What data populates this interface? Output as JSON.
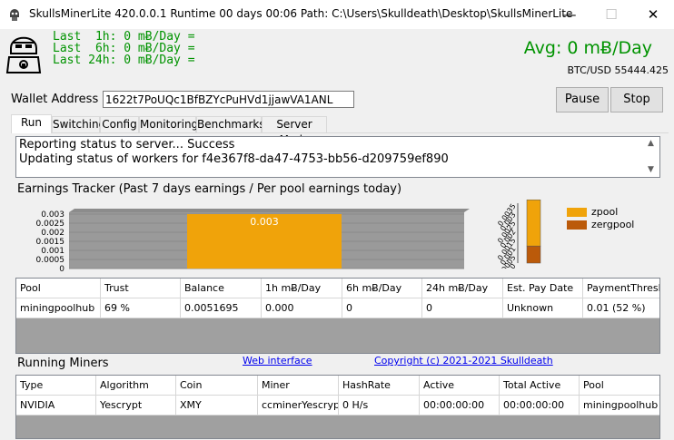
{
  "window": {
    "title": "SkullsMinerLite 420.0.0.1 Runtime 00 days 00:06 Path: C:\\Users\\Skulldeath\\Desktop\\SkullsMinerLite",
    "minimize_glyph": "—",
    "maximize_glyph": "☐",
    "close_glyph": "✕"
  },
  "header": {
    "stats": [
      "Last  1h: 0 mɃ/Day =",
      "Last  6h: 0 mɃ/Day =",
      "Last 24h: 0 mɃ/Day ="
    ],
    "avg": "Avg: 0 mɃ/Day",
    "btc_usd": "BTC/USD 55444.425",
    "accent": "#009300"
  },
  "wallet": {
    "label": "Wallet Address",
    "value": "1622t7PoUQc1BfBZYcPuHVd1jjawVA1ANL"
  },
  "buttons": {
    "pause": "Pause",
    "stop": "Stop"
  },
  "tabs": [
    "Run",
    "Switching",
    "Config",
    "Monitoring",
    "Benchmarks",
    "Server Mode"
  ],
  "active_tab": "Run",
  "log": [
    "Reporting status to server... Success",
    "Updating status of workers for f4e367f8-da47-4753-bb56-d209759ef890"
  ],
  "earnings": {
    "title": "Earnings Tracker (Past 7 days earnings / Per pool earnings today)",
    "chart_data": [
      {
        "type": "bar",
        "ylim": [
          0,
          0.003
        ],
        "y_ticks": [
          "0.003",
          "0.0025",
          "0.002",
          "0.0015",
          "0.001",
          "0.0005",
          "0"
        ],
        "values": [
          0.003
        ],
        "data_labels": [
          "0.003"
        ],
        "bar_color": "#f0a30a"
      },
      {
        "type": "bar",
        "stacked": true,
        "y_ticks": [
          "0.0035",
          "0.003",
          "0.0025",
          "0.002",
          "0.0015",
          "0.001",
          "0.0005",
          "0"
        ],
        "series": [
          {
            "name": "zpool",
            "values": [
              0.0027
            ],
            "color": "#f0a30a"
          },
          {
            "name": "zergpool",
            "values": [
              0.001
            ],
            "color": "#bb5a0a"
          }
        ]
      }
    ]
  },
  "pools": {
    "columns": [
      "Pool",
      "Trust",
      "Balance",
      "1h mɃ/Day",
      "6h mɃ/Day",
      "24h mɃ/Day",
      "Est. Pay Date",
      "PaymentThreshold"
    ],
    "rows": [
      [
        "miningpoolhub",
        "69 %",
        "0.0051695",
        "0.000",
        "0",
        "0",
        "Unknown",
        "0.01 (52 %)"
      ]
    ]
  },
  "miners": {
    "title": "Running Miners",
    "web_interface": "Web interface",
    "copyright": "Copyright (c) 2021-2021 Skulldeath",
    "columns": [
      "Type",
      "Algorithm",
      "Coin",
      "Miner",
      "HashRate",
      "Active",
      "Total Active",
      "Pool"
    ],
    "rows": [
      [
        "NVIDIA",
        "Yescrypt",
        "XMY",
        "ccminerYescrypt",
        "0  H/s",
        "00:00:00:00",
        "00:00:00:00",
        "miningpoolhub"
      ]
    ]
  }
}
